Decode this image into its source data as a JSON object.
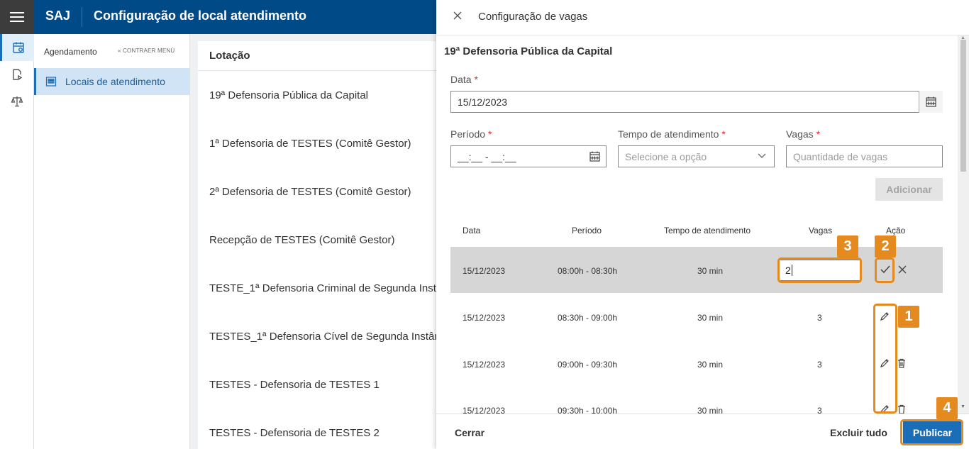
{
  "header": {
    "brand": "SAJ",
    "title": "Configuração de local atendimento"
  },
  "rail": {
    "items": [
      {
        "icon": "calendar-clock-icon",
        "active": true
      },
      {
        "icon": "document-forward-icon",
        "active": false
      },
      {
        "icon": "scales-icon",
        "active": false
      }
    ]
  },
  "submenu": {
    "heading": "Agendamento",
    "collapse_label": "« CONTRAER MENÚ",
    "item_label": "Locais de atendimento"
  },
  "main": {
    "column_header": "Lotação",
    "rows": [
      "19ª Defensoria Pública da Capital",
      "1ª Defensoria de TESTES (Comitê Gestor)",
      "2ª Defensoria de TESTES (Comitê Gestor)",
      "Recepção de TESTES (Comitê Gestor)",
      "TESTE_1ª Defensoria Criminal de Segunda Instância",
      "TESTES_1ª Defensoria Cível de Segunda Instância",
      "TESTES - Defensoria de TESTES 1",
      "TESTES - Defensoria de TESTES 2"
    ]
  },
  "drawer": {
    "title": "Configuração de vagas",
    "org": "19ª Defensoria Pública da Capital",
    "form": {
      "data_label": "Data",
      "data_value": "15/12/2023",
      "periodo_label": "Período",
      "periodo_value": "__:__ - __:__",
      "tempo_label": "Tempo de atendimento",
      "tempo_placeholder": "Selecione a opção",
      "vagas_label": "Vagas",
      "vagas_placeholder": "Quantidade de vagas",
      "required_mark": "*",
      "add_button": "Adicionar"
    },
    "table": {
      "headers": {
        "data": "Data",
        "periodo": "Período",
        "tempo": "Tempo de atendimento",
        "vagas": "Vagas",
        "acao": "Ação"
      },
      "rows": [
        {
          "data": "15/12/2023",
          "periodo": "08:00h - 08:30h",
          "tempo": "30 min",
          "vagas": "2",
          "editing": true
        },
        {
          "data": "15/12/2023",
          "periodo": "08:30h - 09:00h",
          "tempo": "30 min",
          "vagas": "3",
          "editing": false
        },
        {
          "data": "15/12/2023",
          "periodo": "09:00h - 09:30h",
          "tempo": "30 min",
          "vagas": "3",
          "editing": false
        },
        {
          "data": "15/12/2023",
          "periodo": "09:30h - 10:00h",
          "tempo": "30 min",
          "vagas": "3",
          "editing": false
        }
      ]
    },
    "footer": {
      "close": "Cerrar",
      "delete_all": "Excluir tudo",
      "publish": "Publicar"
    }
  },
  "annotations": {
    "color": "#e58a1f",
    "labels": [
      "1",
      "2",
      "3",
      "4"
    ]
  }
}
